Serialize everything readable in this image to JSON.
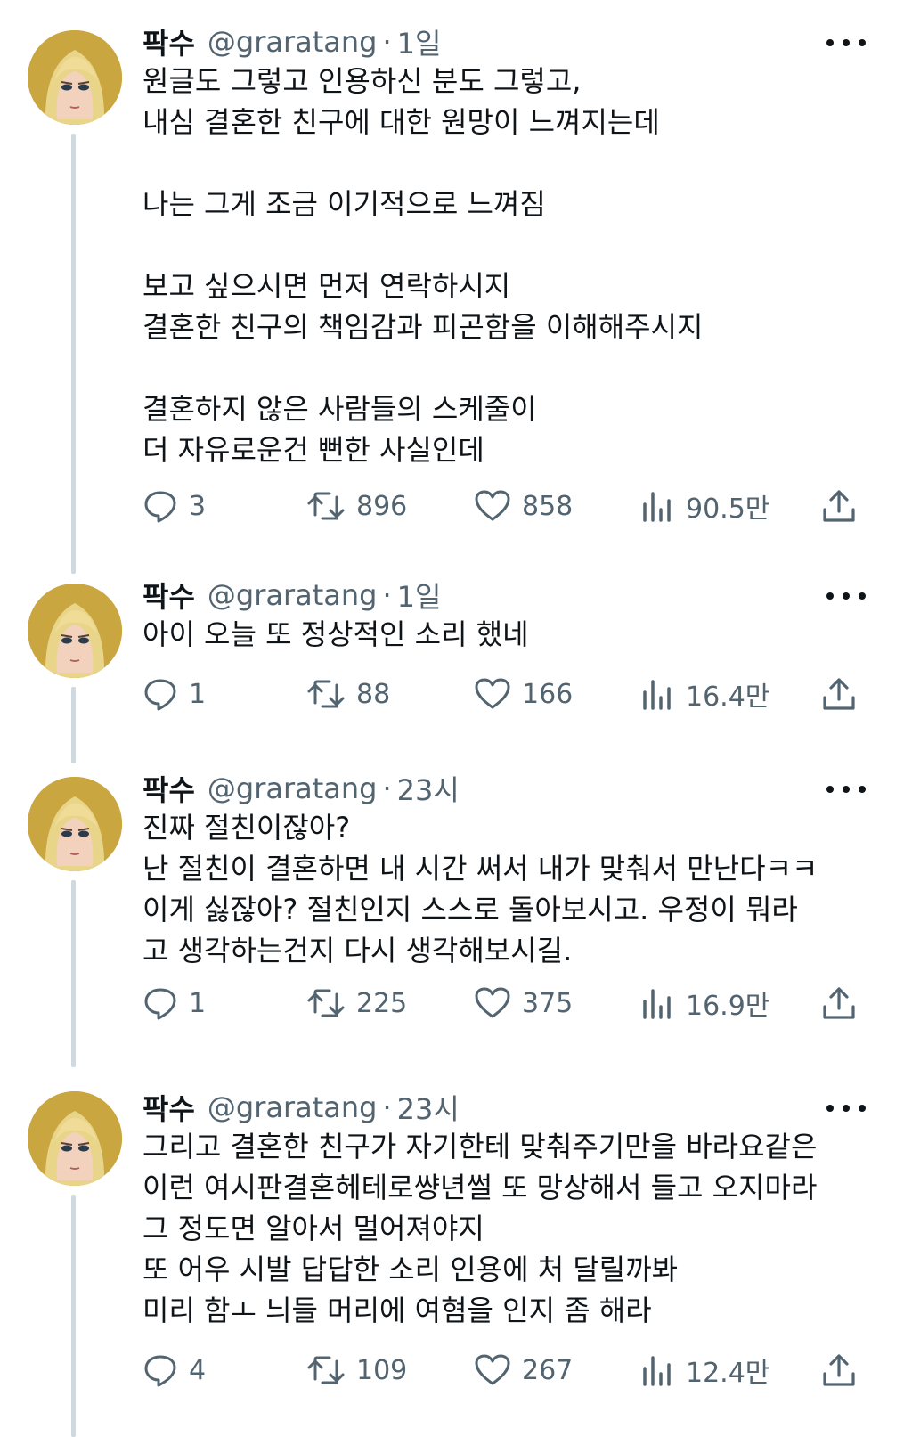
{
  "tweets": [
    {
      "name": "팍수",
      "handle": "@graratang",
      "time": "1일",
      "text": "원글도 그렇고 인용하신 분도 그렇고,\n내심 결혼한 친구에 대한 원망이 느껴지는데\n\n나는 그게 조금 이기적으로 느껴짐\n\n보고 싶으시면 먼저 연락하시지\n결혼한 친구의 책임감과 피곤함을 이해해주시지\n\n결혼하지 않은 사람들의 스케줄이\n더 자유로운건 뻔한 사실인데",
      "replies": "3",
      "retweets": "896",
      "likes": "858",
      "views": "90.5만"
    },
    {
      "name": "팍수",
      "handle": "@graratang",
      "time": "1일",
      "text": "아이 오늘 또 정상적인 소리 했네",
      "replies": "1",
      "retweets": "88",
      "likes": "166",
      "views": "16.4만"
    },
    {
      "name": "팍수",
      "handle": "@graratang",
      "time": "23시",
      "text": "진짜 절친이잖아?\n난 절친이 결혼하면 내 시간 써서 내가 맞춰서 만난다ㅋㅋ\n이게 싫잖아? 절친인지 스스로 돌아보시고. 우정이 뭐라\n고 생각하는건지 다시 생각해보시길.",
      "replies": "1",
      "retweets": "225",
      "likes": "375",
      "views": "16.9만"
    },
    {
      "name": "팍수",
      "handle": "@graratang",
      "time": "23시",
      "text": "그리고 결혼한 친구가 자기한테 맞춰주기만을 바라요같은\n이런 여시판결혼헤테로썅년썰 또 망상해서 들고 오지마라\n그 정도면 알아서 멀어져야지\n또 어우 시발 답답한 소리 인용에 처 달릴까봐\n미리 함ㅗ 늬들 머리에 여혐을 인지 좀 해라",
      "replies": "4",
      "retweets": "109",
      "likes": "267",
      "views": "12.4만"
    }
  ],
  "icons": {
    "reply": "reply-icon",
    "retweet": "retweet-icon",
    "like": "heart-icon",
    "views": "views-icon",
    "share": "share-icon",
    "more": "more-icon"
  },
  "colors": {
    "text": "#0f1419",
    "secondary": "#536471",
    "thread_line": "#cfd9de",
    "avatar_bg": "#c9a640"
  }
}
